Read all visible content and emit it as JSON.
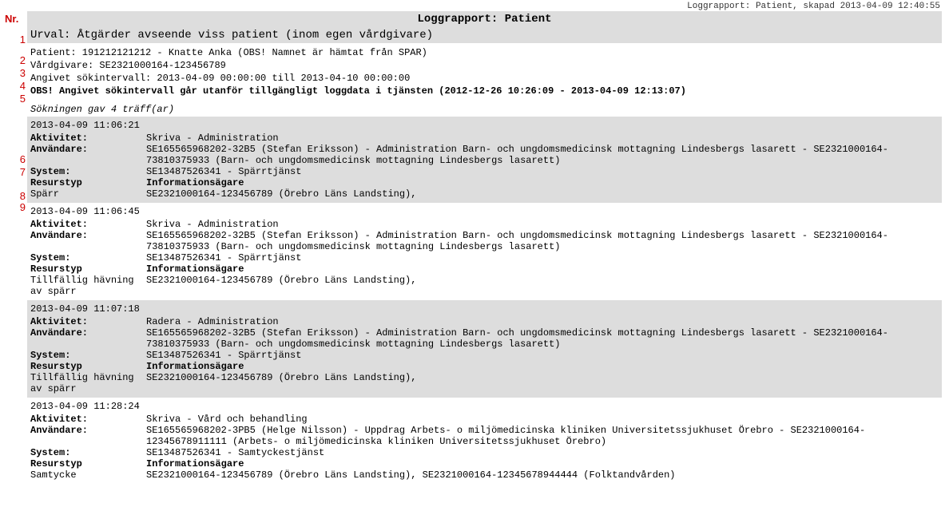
{
  "annotations": {
    "header": "Nr.",
    "n1": "1",
    "n2": "2",
    "n3": "3",
    "n4": "4",
    "n5": "5",
    "n6": "6",
    "n7": "7",
    "n8": "8",
    "n9": "9"
  },
  "top_meta": "Loggrapport: Patient, skapad 2013-04-09 12:40:55",
  "title": "Loggrapport: Patient",
  "urval": "Urval: Åtgärder avseende viss patient (inom egen vårdgivare)",
  "meta": {
    "patient": "Patient: 191212121212 - Knatte Anka (OBS! Namnet är hämtat från SPAR)",
    "vardgivare": "Vårdgivare: SE2321000164-123456789",
    "sokintervall": "Angivet sökintervall: 2013-04-09 00:00:00 till 2013-04-10 00:00:00",
    "obs": "OBS! Angivet sökintervall går utanför tillgängligt loggdata i tjänsten (2012-12-26 10:26:09 - 2013-04-09 12:13:07)"
  },
  "result_count": "Sökningen gav 4 träff(ar)",
  "labels": {
    "aktivitet": "Aktivitet:",
    "anvandare": "Användare:",
    "system": "System:",
    "resurstyp": "Resurstyp",
    "infoagare": "Informationsägare"
  },
  "entries": [
    {
      "ts": "2013-04-09 11:06:21",
      "aktivitet": "Skriva - Administration",
      "anvandare": "SE165565968202-32B5 (Stefan Eriksson) - Administration Barn- och ungdomsmedicinsk mottagning Lindesbergs lasarett - SE2321000164-73810375933 (Barn- och ungdomsmedicinsk mottagning Lindesbergs lasarett)",
      "system": "SE13487526341 - Spärrtjänst",
      "rtype": "Spärr",
      "rinfo": "SE2321000164-123456789 (Örebro Läns Landsting),"
    },
    {
      "ts": "2013-04-09 11:06:45",
      "aktivitet": "Skriva - Administration",
      "anvandare": "SE165565968202-32B5 (Stefan Eriksson) - Administration Barn- och ungdomsmedicinsk mottagning Lindesbergs lasarett - SE2321000164-73810375933 (Barn- och ungdomsmedicinsk mottagning Lindesbergs lasarett)",
      "system": "SE13487526341 - Spärrtjänst",
      "rtype": "Tillfällig hävning av spärr",
      "rinfo": "SE2321000164-123456789 (Örebro Läns Landsting),"
    },
    {
      "ts": "2013-04-09 11:07:18",
      "aktivitet": "Radera - Administration",
      "anvandare": "SE165565968202-32B5 (Stefan Eriksson) - Administration Barn- och ungdomsmedicinsk mottagning Lindesbergs lasarett - SE2321000164-73810375933 (Barn- och ungdomsmedicinsk mottagning Lindesbergs lasarett)",
      "system": "SE13487526341 - Spärrtjänst",
      "rtype": "Tillfällig hävning av spärr",
      "rinfo": "SE2321000164-123456789 (Örebro Läns Landsting),"
    },
    {
      "ts": "2013-04-09 11:28:24",
      "aktivitet": "Skriva - Vård och behandling",
      "anvandare": "SE165565968202-3PB5 (Helge Nilsson) - Uppdrag Arbets- o miljömedicinska kliniken Universitetssjukhuset Örebro - SE2321000164-12345678911111 (Arbets- o miljömedicinska kliniken Universitetssjukhuset Örebro)",
      "system": "SE13487526341 - Samtyckestjänst",
      "rtype": "Samtycke",
      "rinfo": "SE2321000164-123456789 (Örebro Läns Landsting), SE2321000164-12345678944444 (Folktandvården)"
    }
  ]
}
